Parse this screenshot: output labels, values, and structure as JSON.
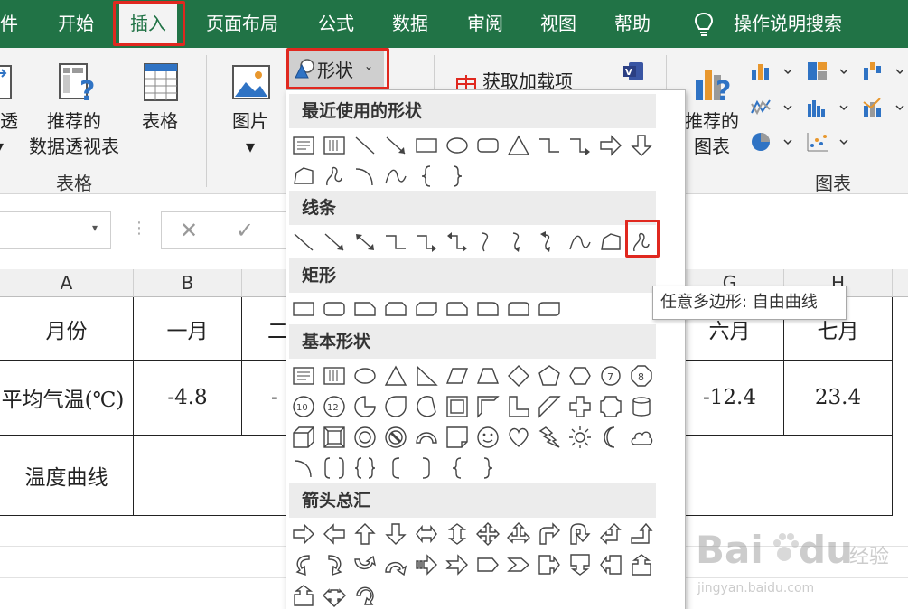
{
  "menubar": {
    "tabs": [
      "件",
      "开始",
      "插入",
      "页面布局",
      "公式",
      "数据",
      "审阅",
      "视图",
      "帮助"
    ],
    "active_tab": "插入",
    "search_label": "操作说明搜索"
  },
  "ribbon": {
    "pivot_partial_label": "透",
    "recommended_pivot_label_1": "推荐的",
    "recommended_pivot_label_2": "数据透视表",
    "table_label": "表格",
    "group_tables_label": "表格",
    "pictures_label": "图片",
    "shapes_label": "形状",
    "addins_label": "获取加载项",
    "recommended_charts_label_1": "推荐的",
    "recommended_charts_label_2": "图表",
    "group_charts_label": "图表"
  },
  "grid": {
    "columns": [
      "A",
      "B",
      "G",
      "H"
    ],
    "rows": [
      {
        "label": "月份",
        "b": "一月",
        "c_partial": "二",
        "g": "六月",
        "h": "七月"
      },
      {
        "label": "平均气温(℃)",
        "b": "-4.8",
        "c_partial": "-",
        "g": "-12.4",
        "h": "23.4"
      },
      {
        "label": "温度曲线"
      }
    ]
  },
  "dropdown": {
    "sections": [
      "最近使用的形状",
      "线条",
      "矩形",
      "基本形状",
      "箭头总汇"
    ],
    "tooltip": "任意多边形: 自由曲线"
  },
  "watermark": {
    "brand": "Bai",
    "brand_suffix": "经验",
    "url": "jingyan.baidu.com"
  },
  "colors": {
    "menubar": "#217346",
    "highlight": "#e0281f",
    "icon_blue": "#2f73c4",
    "icon_orange": "#e8972d"
  }
}
